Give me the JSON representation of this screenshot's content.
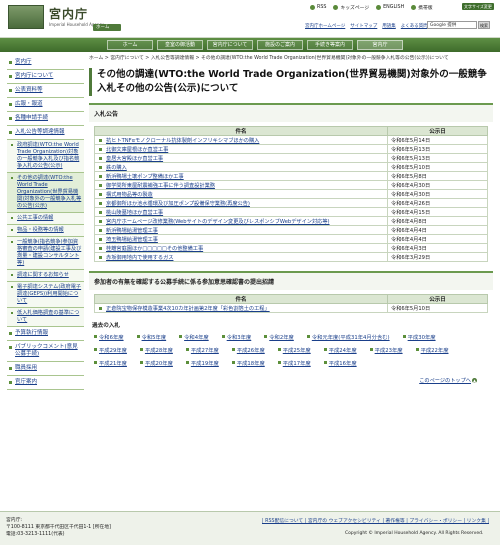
{
  "header": {
    "title_jp": "宮内庁",
    "title_en": "Imperial Household Agency",
    "home": "ホーム",
    "top_links": [
      "RSS",
      "キッズページ",
      "ENGLISH",
      "携帯版"
    ],
    "font_button": "文字サイズ変更",
    "sub_links": [
      "宮内庁ホームページ",
      "サイトマップ",
      "用語集",
      "よくある質問"
    ],
    "search_value": "Google 提供",
    "search_button": "検索"
  },
  "nav": [
    "ホーム",
    "皇室の御活動",
    "宮内庁について",
    "施設のご案内",
    "手続き等案内",
    "宮内庁"
  ],
  "sidebar": {
    "items": [
      "宮内庁",
      "宮内庁について",
      "公表資料等",
      "広報・報道",
      "各種申請手続",
      "入札公告等調達情報"
    ],
    "subs": [
      "政府調達(WTO:the World Trade Organization)対象の一般競争入札及び指名競争入札の公告(公示)",
      "その他の調達(WTO:the World Trade Organization(世界貿易機関)対象外の一般競争入札等の公告(公示)"
    ],
    "items2": [
      "公共工事の情報",
      "物品・役務等の情報",
      "一般競争(指名競争)参加資格審査の申請(建設工事及び測量・建設コンサルタント等)",
      "調達に関するお知らせ",
      "電子調達システム(政府電子調達(GEPS))利用開始について",
      "低入札価格調査の基準について",
      "予算執行情報",
      "パブリックコメント(意見公募手続)",
      "職員採用",
      "官庁案内"
    ]
  },
  "breadcrumb": "ホーム > 宮内庁について > 入札公告等調達情報 > その他の調達(WTO:the World Trade Organization(世界貿易機関)対象外の一般競争入札等の公告(公示))について",
  "page_title": "その他の調達(WTO:the World Trade Organization(世界貿易機関)対象外の一般競争入札その他の公告(公示)について",
  "section1": "入札公告",
  "table_headers": [
    "件名",
    "公示日"
  ],
  "notices": [
    [
      "抗ヒトTNFαモノクローナル抗体製剤インフリキシマブほかの購入",
      "令和6年5月14日"
    ],
    [
      "北御文庫屋根ほか直営工事",
      "令和6年5月13日"
    ],
    [
      "皇居大宮殿ほか直営工事",
      "令和6年5月13日"
    ],
    [
      "鉄の購入",
      "令和6年5月10日"
    ],
    [
      "新浜鴨場土壌ポンプ整備ほか工事",
      "令和6年5月8日"
    ],
    [
      "御学問所東屋耐震補強工事に伴う調査設計業務",
      "令和6年4月30日"
    ],
    [
      "構式用物品等の製造",
      "令和6年4月30日"
    ],
    [
      "京都御所ほか池水循環及び加圧ポンプ設備保守業務(再度公告)",
      "令和6年4月26日"
    ],
    [
      "桃山陵墓地ほか直営工事",
      "令和6年4月15日"
    ],
    [
      "宮内庁ホームページ改修業務(Webサイトのデザイン変更及びレスポンシブWebデザイン対応等)",
      "令和6年4月8日"
    ],
    [
      "新浜鴨場給湯管理工事",
      "令和6年4月4日"
    ],
    [
      "埼玉鴨場給湯管理工事",
      "令和6年4月4日"
    ],
    [
      "桂離宮庭園ほか□□□□□その他整備工事",
      "令和6年4月3日"
    ],
    [
      "赤坂御用地内で使用するガス",
      "令和6年3月29日"
    ]
  ],
  "section2": "参加者の有無を確認する公募手続に係る参加意思確認書の提出招請",
  "invites": [
    [
      "正倉院宝物保存模造事業4次10カ年計画第2年度「彩色割箔土の工程」",
      "令和6年5月10日"
    ]
  ],
  "past_heading": "過去の入札",
  "past_years": [
    "令和6年度",
    "令和5年度",
    "令和4年度",
    "令和3年度",
    "令和2年度",
    "令和元年度(平成31年4月分含む)",
    "平成30年度",
    "平成29年度",
    "平成28年度",
    "平成27年度",
    "平成26年度",
    "平成25年度",
    "平成24年度",
    "平成23年度",
    "平成22年度",
    "平成21年度",
    "平成20年度",
    "平成19年度",
    "平成18年度",
    "平成17年度",
    "平成16年度"
  ],
  "to_top": "このページのトップへ",
  "footer": {
    "addr1": "宮内庁:",
    "addr2": "〒100-8111 東京都千代田区千代田1-1 [所在地]",
    "addr3": "電話:03-3213-1111(代表)",
    "links": "| RSS配信について | 宮内庁の ウェブアクセシビリティ | 著作権等 | プライバシー・ポリシー | リンク集 |",
    "copy": "Copyright © Imperial Household Agency. All Rights Reserved."
  }
}
